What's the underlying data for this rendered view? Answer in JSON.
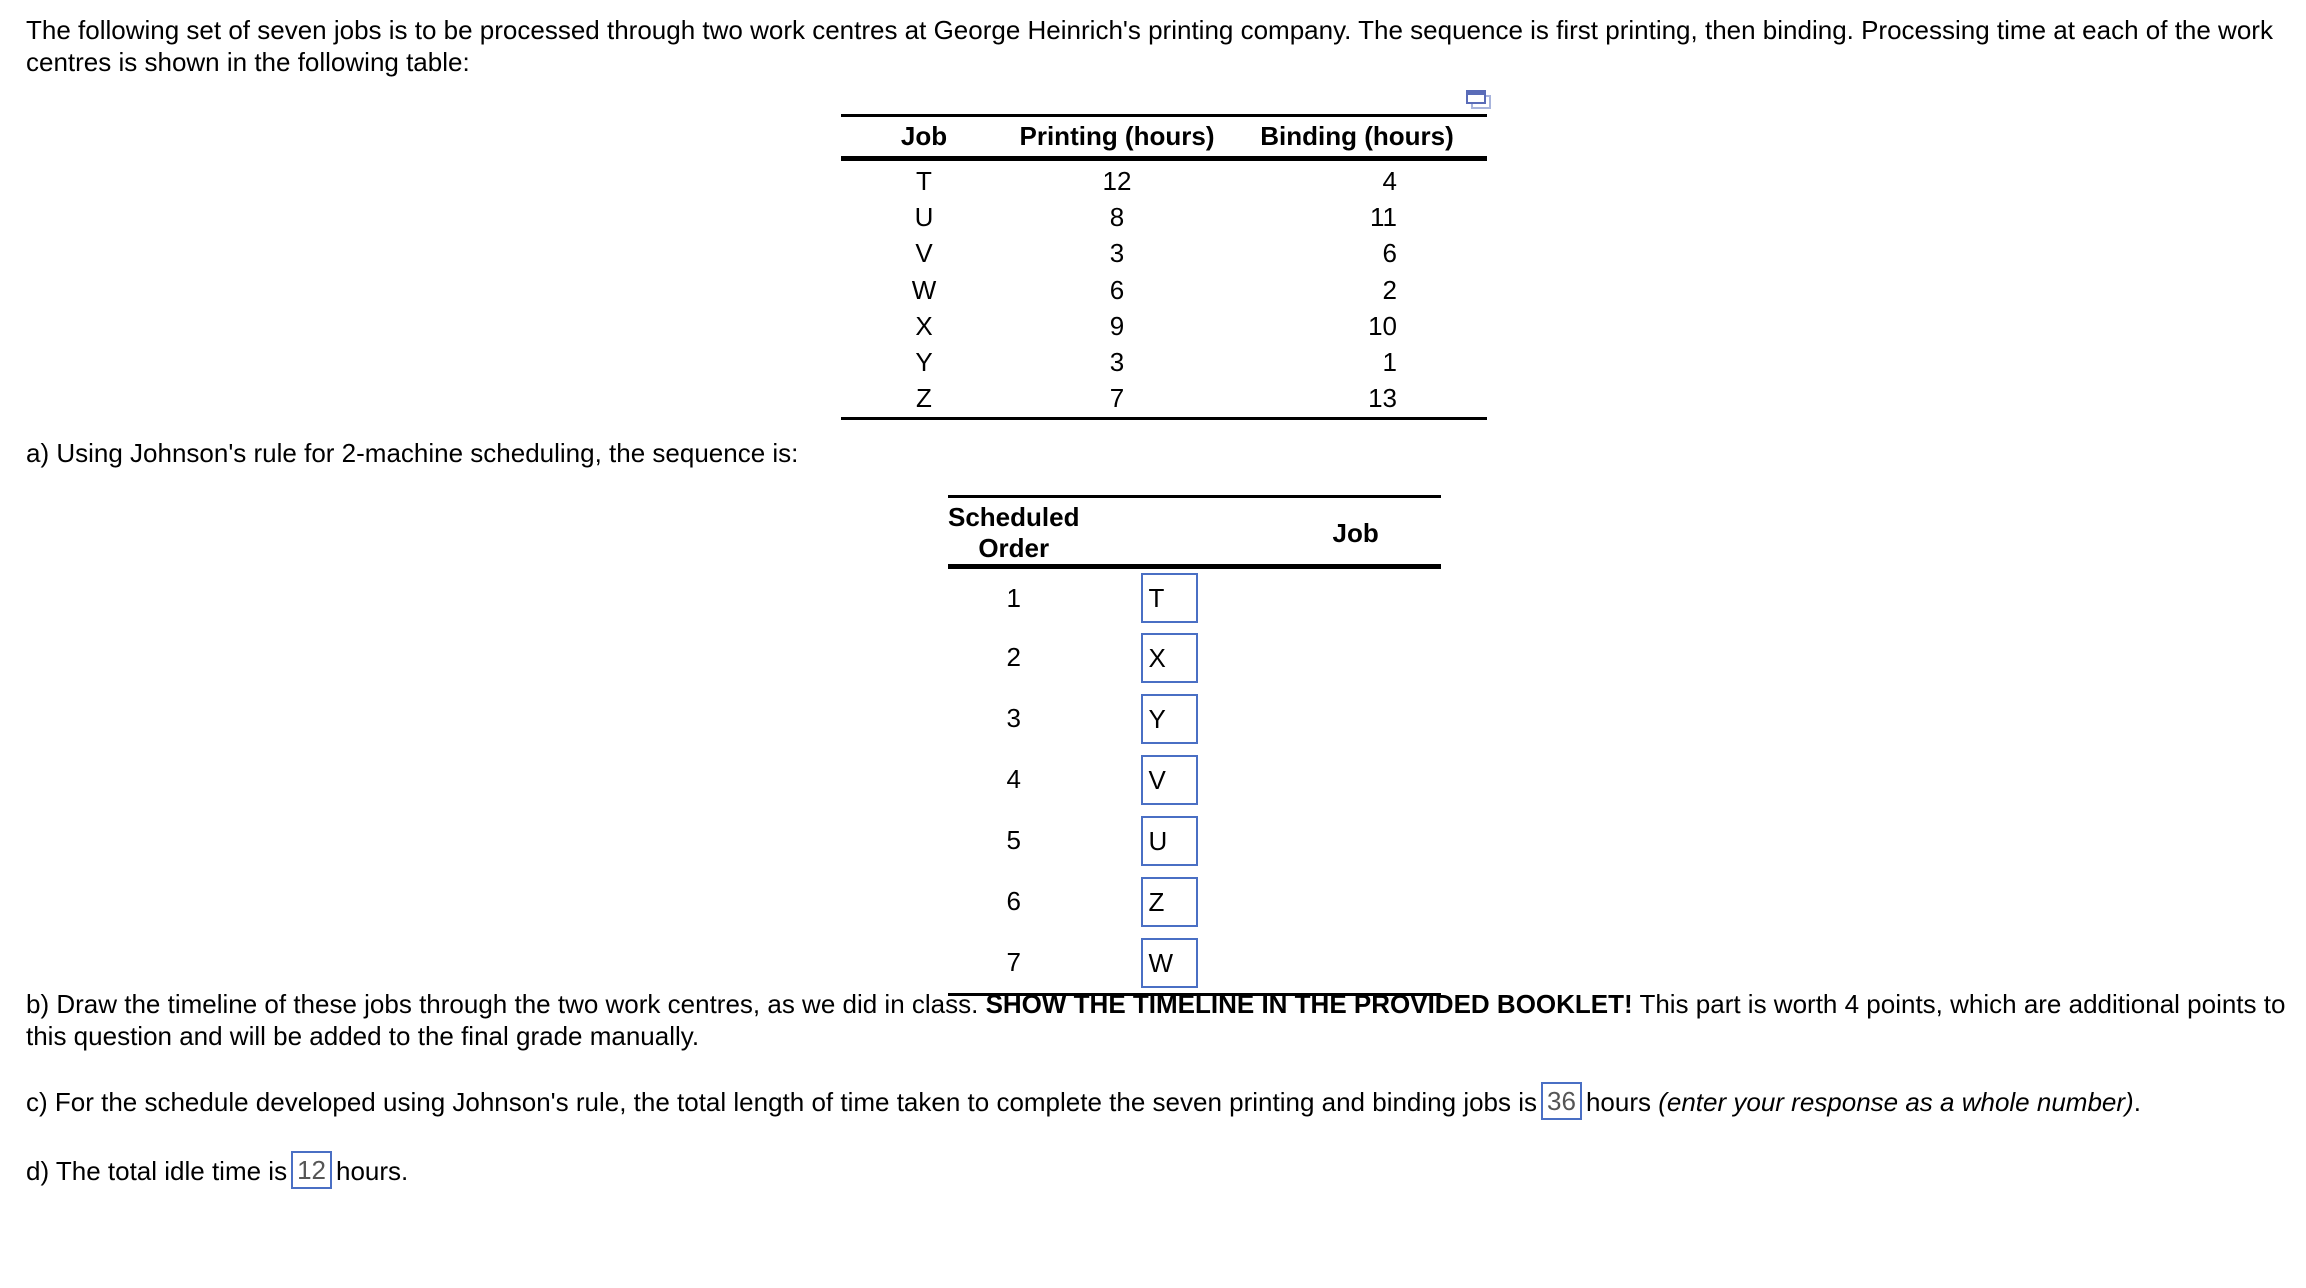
{
  "intro": "The following set of seven jobs is to be processed through two work centres at George Heinrich's printing company. The sequence is first printing, then binding. Processing time at each of the work centres is shown in the following table:",
  "data_table": {
    "headers": [
      "Job",
      "Printing (hours)",
      "Binding (hours)"
    ],
    "rows": [
      {
        "job": "T",
        "printing": "12",
        "binding": "4"
      },
      {
        "job": "U",
        "printing": "8",
        "binding": "11"
      },
      {
        "job": "V",
        "printing": "3",
        "binding": "6"
      },
      {
        "job": "W",
        "printing": "6",
        "binding": "2"
      },
      {
        "job": "X",
        "printing": "9",
        "binding": "10"
      },
      {
        "job": "Y",
        "printing": "3",
        "binding": "1"
      },
      {
        "job": "Z",
        "printing": "7",
        "binding": "13"
      }
    ],
    "popout_icon": "popout-window-icon"
  },
  "part_a": {
    "text": "a) Using Johnson's rule for 2-machine scheduling, the sequence is:"
  },
  "sequence_table": {
    "headers": [
      "Scheduled Order",
      "Job"
    ],
    "rows": [
      {
        "order": "1",
        "job": "T"
      },
      {
        "order": "2",
        "job": "X"
      },
      {
        "order": "3",
        "job": "Y"
      },
      {
        "order": "4",
        "job": "V"
      },
      {
        "order": "5",
        "job": "U"
      },
      {
        "order": "6",
        "job": "Z"
      },
      {
        "order": "7",
        "job": "W"
      }
    ]
  },
  "part_b": {
    "prefix": "b) Draw the timeline of these jobs through the two work centres, as we did in class. ",
    "bold": "SHOW THE TIMELINE IN THE PROVIDED BOOKLET!",
    "suffix": " This part is worth 4 points, which are additional points to this question and will be added to the final grade manually."
  },
  "part_c": {
    "prefix": "c) For the schedule developed using Johnson's rule, the total length of time taken to complete the seven printing and binding jobs is",
    "answer": "36",
    "suffix": "hours",
    "hint": "(enter your response as a whole number)",
    "end": "."
  },
  "part_d": {
    "prefix": "d) The total idle time is",
    "answer": "12",
    "suffix": "hours."
  },
  "colors": {
    "answer_border": "#4a6fc4",
    "answer_text": "#555555",
    "text": "#000000"
  }
}
